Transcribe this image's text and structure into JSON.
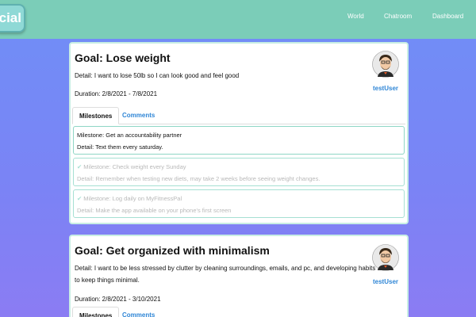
{
  "app": {
    "logo_text": "ocial"
  },
  "nav": {
    "items": [
      "World",
      "Chatroom",
      "Dashboard"
    ]
  },
  "goals": [
    {
      "title": "Goal: Lose weight",
      "detail": "Detail: I want to lose 50lb so I can look good and feel good",
      "duration": "Duration:  2/8/2021 - 7/8/2021",
      "user": "testUser",
      "tabs": [
        "Milestones",
        "Comments"
      ],
      "milestones": [
        {
          "milestone": "Milestone: Get an accountability partner",
          "detail": "Detail: Text them every saturday.",
          "done": false
        },
        {
          "milestone": "Milestone: Check weight every Sunday",
          "detail": "Detail: Remember when testing new diets, may take 2 weeks before seeing weight changes.",
          "done": true
        },
        {
          "milestone": "Milestone: Log daily on MyFitnessPal",
          "detail": "Detail: Make the app available on your phone's first screen",
          "done": true
        }
      ]
    },
    {
      "title": "Goal: Get organized with minimalism",
      "detail": "Detail: I want to be less stressed by clutter by cleaning surroundings, emails, and pc, and developing habits to keep things minimal.",
      "duration": "Duration:  2/8/2021 - 3/10/2021",
      "user": "testUser",
      "tabs": [
        "Milestones",
        "Comments"
      ]
    }
  ],
  "colors": {
    "navbar": "#7bcdb8",
    "background_top": "#6f8ff7",
    "background_bottom": "#8b7cf3",
    "link": "#2f86d6",
    "milestone_border": "#8ed6c5"
  },
  "icons": {
    "check": "check-icon",
    "avatar": "avatar-icon"
  }
}
